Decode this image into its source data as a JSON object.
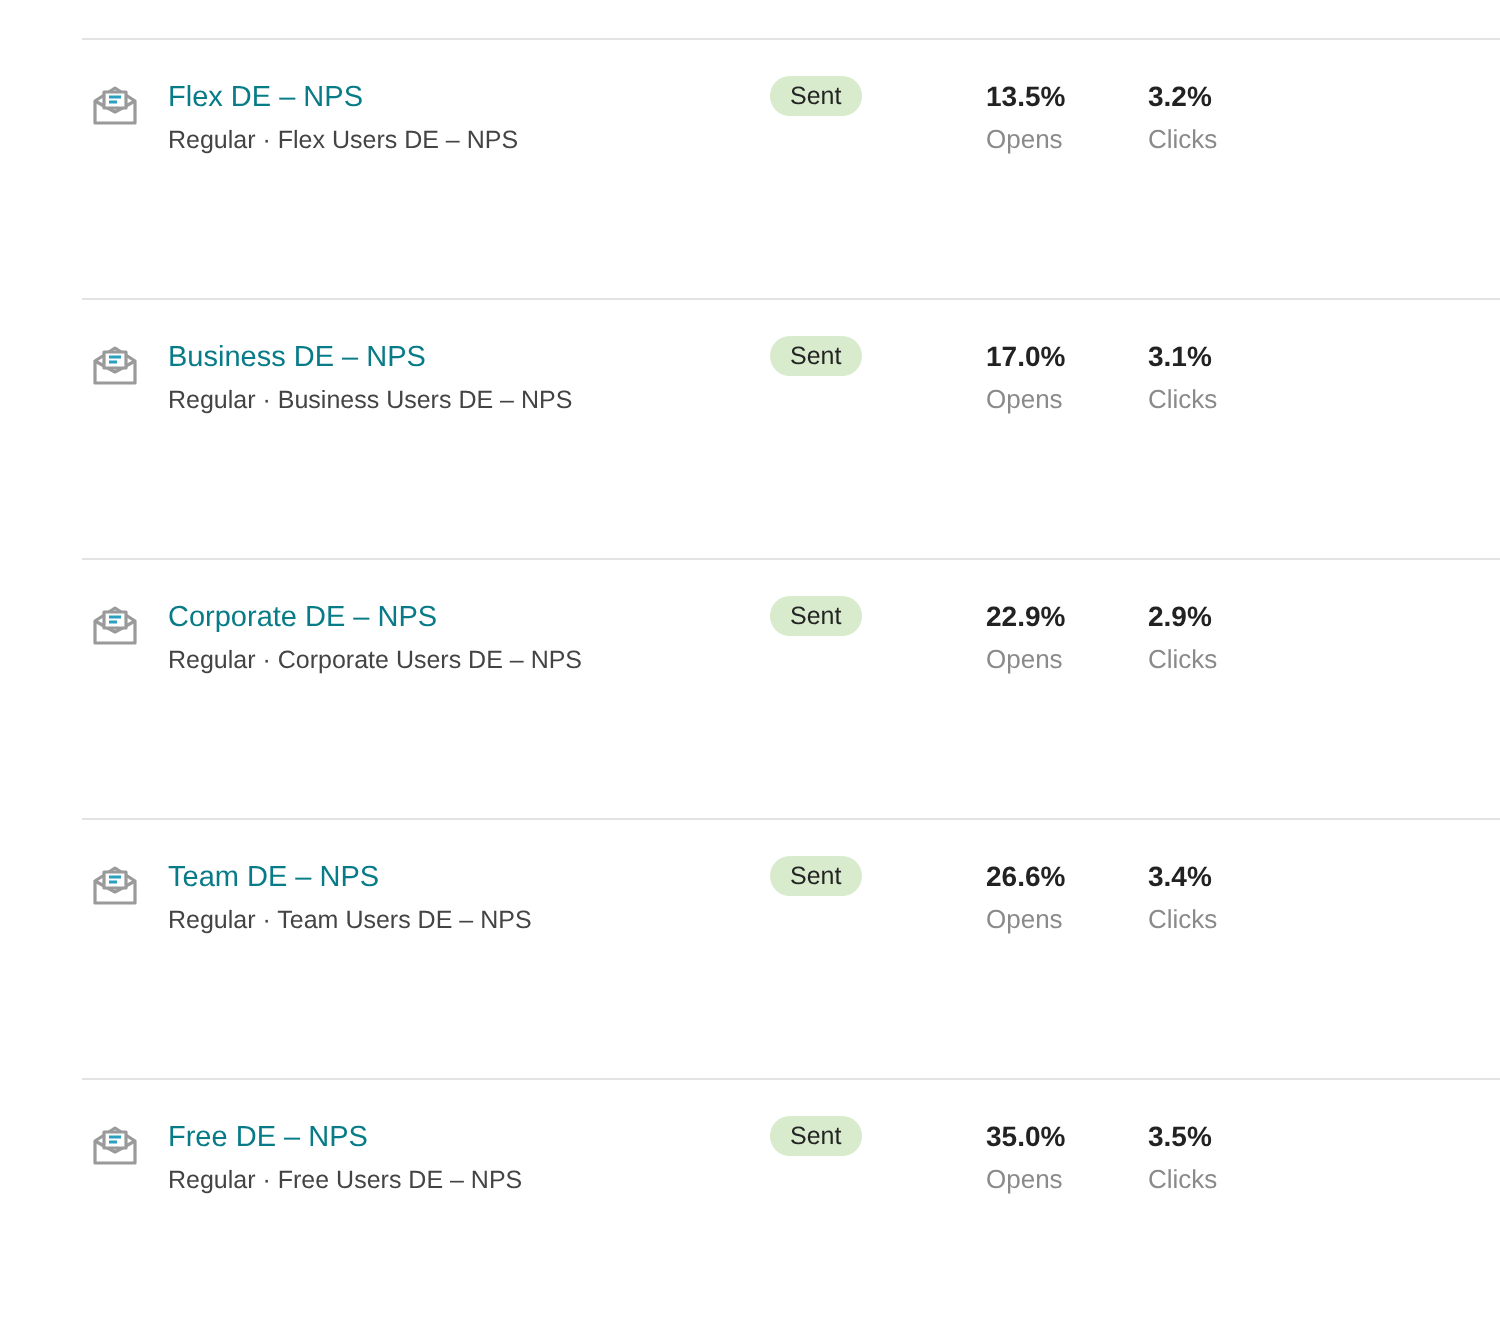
{
  "campaigns": [
    {
      "title": "Flex DE – NPS",
      "subtitle": "Regular · Flex Users DE – NPS",
      "status": "Sent",
      "opens": "13.5%",
      "opens_label": "Opens",
      "clicks": "3.2%",
      "clicks_label": "Clicks"
    },
    {
      "title": "Business DE – NPS",
      "subtitle": "Regular · Business Users DE – NPS",
      "status": "Sent",
      "opens": "17.0%",
      "opens_label": "Opens",
      "clicks": "3.1%",
      "clicks_label": "Clicks"
    },
    {
      "title": "Corporate DE – NPS",
      "subtitle": "Regular · Corporate Users DE – NPS",
      "status": "Sent",
      "opens": "22.9%",
      "opens_label": "Opens",
      "clicks": "2.9%",
      "clicks_label": "Clicks"
    },
    {
      "title": "Team DE – NPS",
      "subtitle": "Regular · Team Users DE – NPS",
      "status": "Sent",
      "opens": "26.6%",
      "opens_label": "Opens",
      "clicks": "3.4%",
      "clicks_label": "Clicks"
    },
    {
      "title": "Free DE – NPS",
      "subtitle": "Regular · Free Users DE – NPS",
      "status": "Sent",
      "opens": "35.0%",
      "opens_label": "Opens",
      "clicks": "3.5%",
      "clicks_label": "Clicks"
    }
  ]
}
